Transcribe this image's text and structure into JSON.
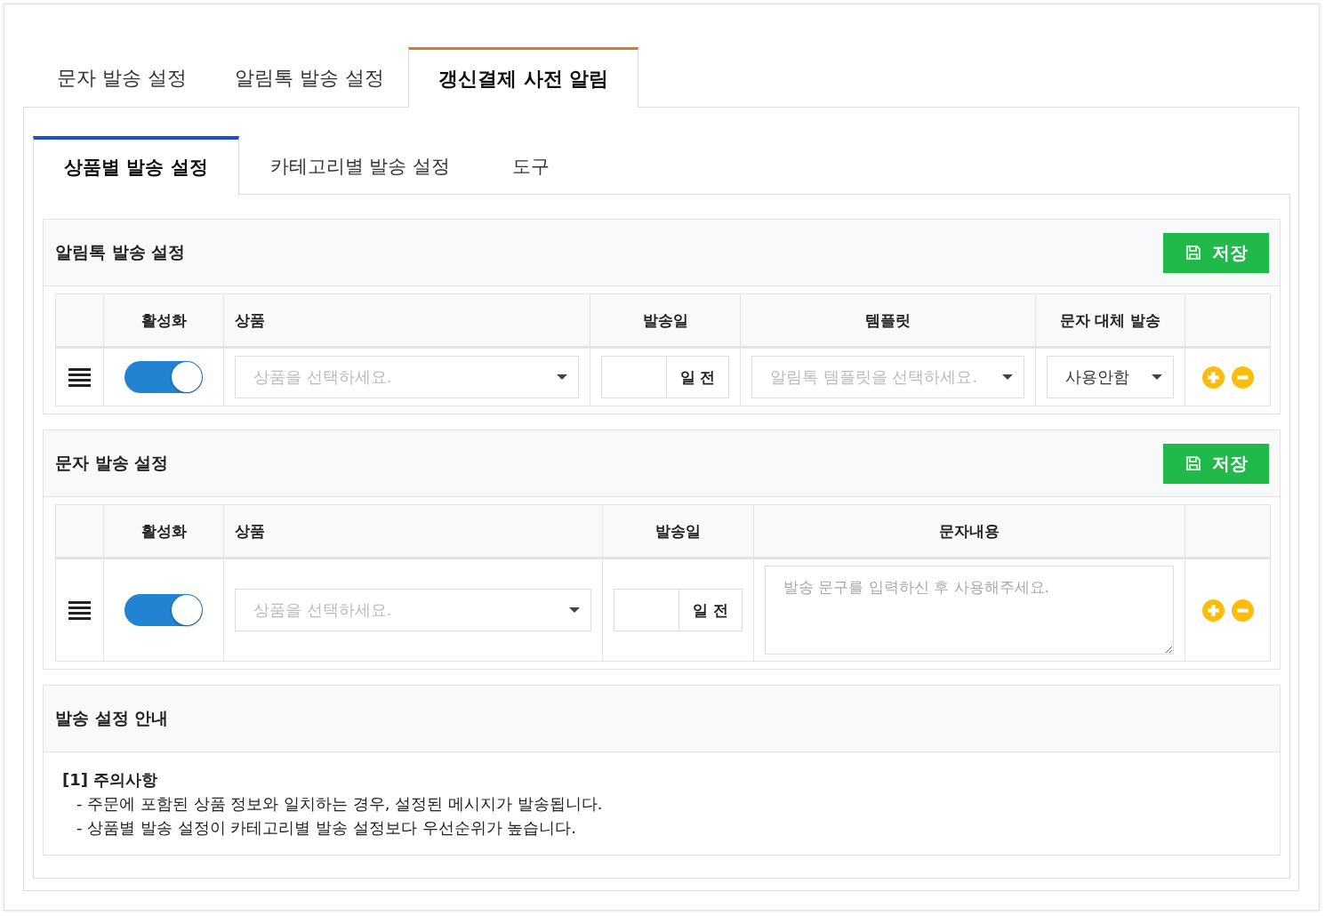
{
  "top_tabs": [
    {
      "label": "문자 발송 설정",
      "selected": false
    },
    {
      "label": "알림톡 발송 설정",
      "selected": false
    },
    {
      "label": "갱신결제 사전 알림",
      "selected": true
    }
  ],
  "sub_tabs": [
    {
      "label": "상품별 발송 설정",
      "selected": true
    },
    {
      "label": "카테고리별 발송 설정",
      "selected": false
    },
    {
      "label": "도구",
      "selected": false
    }
  ],
  "alimtalk_panel": {
    "title": "알림톡 발송 설정",
    "save_button": "저장",
    "columns": [
      "활성화",
      "상품",
      "발송일",
      "템플릿",
      "문자 대체 발송"
    ],
    "rows": [
      {
        "enabled": true,
        "product_placeholder": "상품을 선택하세요.",
        "days_suffix": "일 전",
        "template_placeholder": "알림톡 템플릿을 선택하세요.",
        "fallback_value": "사용안함"
      }
    ]
  },
  "sms_panel": {
    "title": "문자 발송 설정",
    "save_button": "저장",
    "columns": [
      "활성화",
      "상품",
      "발송일",
      "문자내용"
    ],
    "rows": [
      {
        "enabled": true,
        "product_placeholder": "상품을 선택하세요.",
        "days_suffix": "일 전",
        "message_placeholder": "발송 문구를 입력하신 후 사용해주세요."
      }
    ]
  },
  "guide": {
    "title": "발송 설정 안내",
    "heading": "[1] 주의사항",
    "lines": [
      "- 주문에 포함된 상품 정보와 일치하는 경우, 설정된 메시지가 발송됩니다.",
      "- 상품별 발송 설정이 카테고리별 발송 설정보다 우선순위가 높습니다."
    ]
  }
}
